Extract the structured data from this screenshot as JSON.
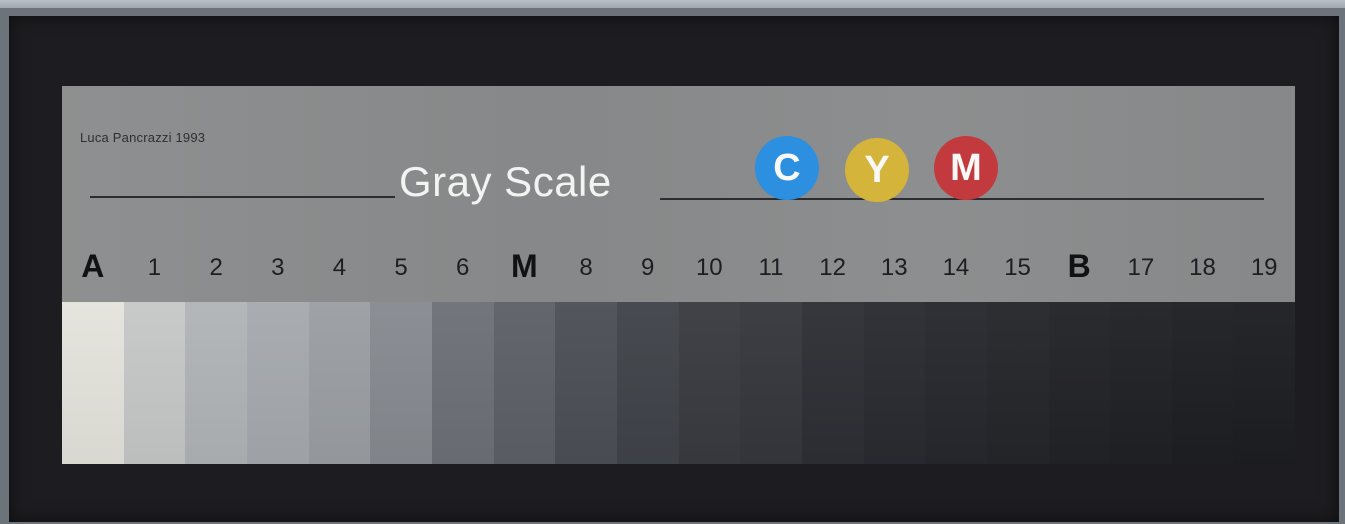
{
  "painting": {
    "signature": "Luca Pancrazzi  1993",
    "title": "Gray Scale",
    "badges": [
      {
        "letter": "C",
        "color": "#2c8fe0"
      },
      {
        "letter": "Y",
        "color": "#d4b43a"
      },
      {
        "letter": "M",
        "color": "#c23a3e"
      }
    ],
    "scale_labels": [
      "A",
      "1",
      "2",
      "3",
      "4",
      "5",
      "6",
      "M",
      "8",
      "9",
      "10",
      "11",
      "12",
      "13",
      "14",
      "15",
      "B",
      "17",
      "18",
      "19"
    ],
    "swatch_colors": [
      "#e4e3dc",
      "#c6c8c7",
      "#b1b4b7",
      "#a6a9ae",
      "#9b9ea3",
      "#878a90",
      "#6d7077",
      "#5d6067",
      "#4c4f56",
      "#404349",
      "#393b41",
      "#35373d",
      "#2e2f34",
      "#2a2b30",
      "#27282d",
      "#25262a",
      "#222327",
      "#202125",
      "#1e1f23",
      "#1d1e22"
    ]
  }
}
